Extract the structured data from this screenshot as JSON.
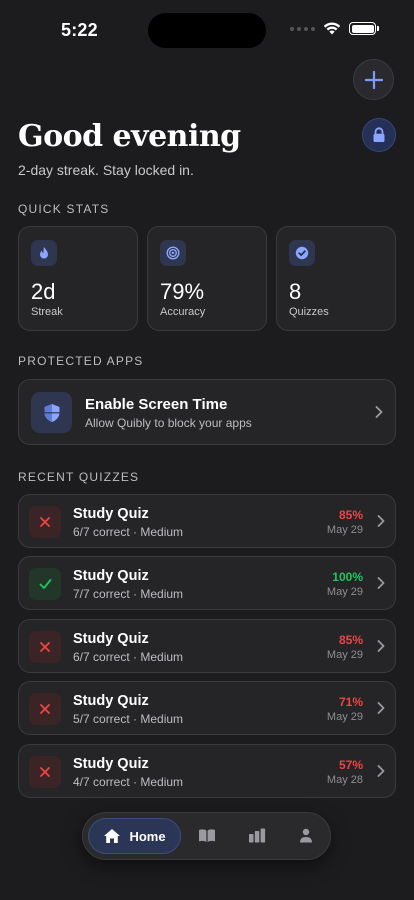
{
  "status": {
    "time": "5:22"
  },
  "header": {
    "greeting": "Good evening",
    "subtitle": "2-day streak. Stay locked in.",
    "add_icon": "plus-icon",
    "lock_icon": "lock-icon"
  },
  "quick_stats": {
    "label": "QUICK STATS",
    "items": [
      {
        "value": "2d",
        "label": "Streak",
        "icon": "flame-icon"
      },
      {
        "value": "79%",
        "label": "Accuracy",
        "icon": "target-icon"
      },
      {
        "value": "8",
        "label": "Quizzes",
        "icon": "check-badge-icon"
      }
    ]
  },
  "protected_apps": {
    "label": "PROTECTED APPS",
    "title": "Enable Screen Time",
    "subtitle": "Allow Quibly to block your apps",
    "icon": "shield-icon"
  },
  "recent_quizzes": {
    "label": "RECENT QUIZZES",
    "items": [
      {
        "title": "Study Quiz",
        "detail": "6/7 correct · Medium",
        "score": "85%",
        "date": "May 29",
        "status": "fail"
      },
      {
        "title": "Study Quiz",
        "detail": "7/7 correct · Medium",
        "score": "100%",
        "date": "May 29",
        "status": "pass"
      },
      {
        "title": "Study Quiz",
        "detail": "6/7 correct · Medium",
        "score": "85%",
        "date": "May 29",
        "status": "fail"
      },
      {
        "title": "Study Quiz",
        "detail": "5/7 correct · Medium",
        "score": "71%",
        "date": "May 29",
        "status": "fail"
      },
      {
        "title": "Study Quiz",
        "detail": "4/7 correct · Medium",
        "score": "57%",
        "date": "May 28",
        "status": "fail"
      }
    ]
  },
  "tabbar": {
    "home_label": "Home",
    "tabs": [
      "home-icon",
      "book-icon",
      "chart-icon",
      "person-icon"
    ]
  },
  "colors": {
    "accent": "#7b9cff",
    "fail": "#ef4444",
    "pass": "#22c55e",
    "background": "#1c1c1e"
  }
}
